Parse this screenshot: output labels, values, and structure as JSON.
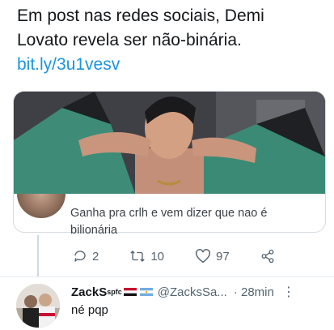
{
  "tweet": {
    "text_line1": "Em post nas redes sociais, Demi",
    "text_line2": "Lovato revela ser não-binária.",
    "link": "bit.ly/3u1vesv"
  },
  "quoted_reply": {
    "text_line1": "Ganha pra crlh e vem dizer que nao é",
    "text_line2": "bilionária",
    "actions": {
      "reply_count": "2",
      "retweet_count": "10",
      "like_count": "97"
    }
  },
  "reply": {
    "name": "ZackS",
    "name_sup": "spfc",
    "handle": "@ZacksSa...",
    "time": "· 28min",
    "more": "⋮",
    "text": "né pqp"
  },
  "icons": [
    "reply-icon",
    "retweet-icon",
    "like-icon",
    "share-icon",
    "more-icon"
  ],
  "colors": {
    "link": "#1b95e0",
    "muted": "#536471",
    "text": "#14171a"
  }
}
